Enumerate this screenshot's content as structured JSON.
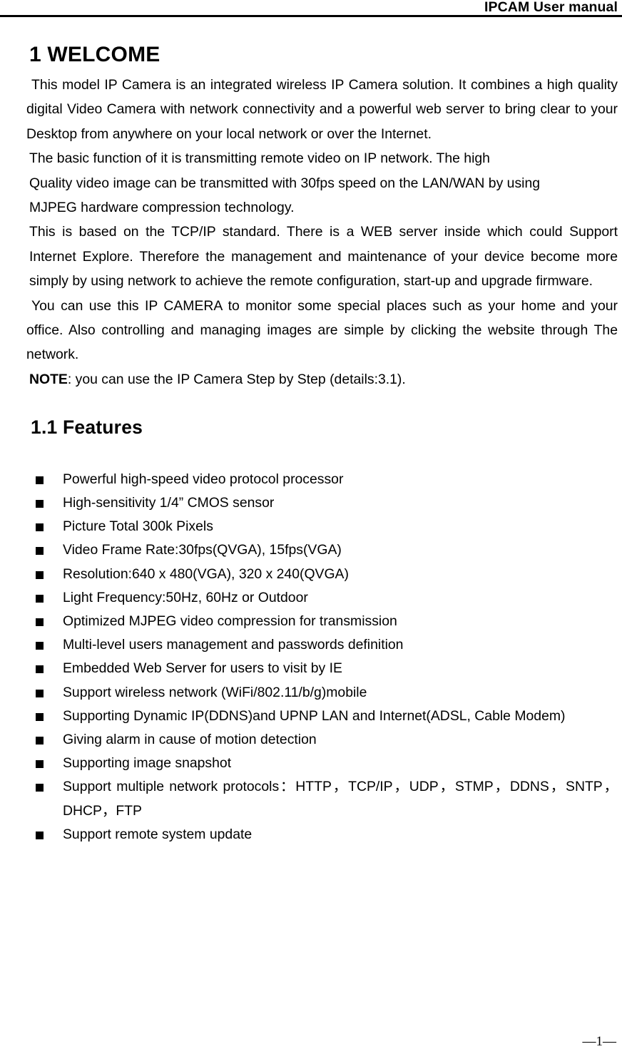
{
  "header": {
    "title": "IPCAM User manual"
  },
  "headings": {
    "h1": "1 WELCOME",
    "h2": "1.1 Features"
  },
  "intro": {
    "paragraph1": "This model IP Camera is an integrated wireless IP Camera solution. It combines a high quality digital Video Camera with network connectivity and a powerful web server to bring clear to your Desktop from anywhere on your local network or over the Internet.",
    "line_basic_1": "The basic function of it is transmitting remote video on IP network. The high",
    "line_basic_2": "Quality video image can be transmitted with 30fps speed on the LAN/WAN by using",
    "line_basic_3": "MJPEG hardware compression technology.",
    "paragraph_tcpip": "This is based on the TCP/IP standard. There is a WEB server inside which could Support Internet Explore. Therefore the management and maintenance of your device become more simply by using network to achieve the remote configuration, start-up and upgrade firmware.",
    "paragraph_monitor": "You can use this IP CAMERA to monitor some special places such as your home and your office. Also controlling and managing images are simple by clicking the website through The network.",
    "note_label": "NOTE",
    "note_text": ": you can use the IP Camera Step by Step (details:3.1)."
  },
  "features": {
    "items": [
      "Powerful high-speed video protocol processor",
      "High-sensitivity 1/4” CMOS sensor",
      "Picture Total 300k Pixels",
      "Video Frame Rate:30fps(QVGA), 15fps(VGA)",
      "Resolution:640 x 480(VGA), 320 x 240(QVGA)",
      "Light Frequency:50Hz, 60Hz or Outdoor",
      "Optimized MJPEG video compression for transmission",
      "Multi-level users management and passwords definition",
      "Embedded Web Server for users to visit by IE",
      "Support wireless network (WiFi/802.11/b/g)mobile",
      "Supporting Dynamic IP(DDNS)and UPNP LAN and Internet(ADSL, Cable Modem)",
      "Giving alarm in cause of motion detection",
      "Supporting image snapshot",
      "Support multiple network protocols：HTTP，TCP/IP，UDP，STMP，DDNS，SNTP，DHCP，FTP",
      "Support remote system update"
    ]
  },
  "footer": {
    "page_number": "—1—"
  }
}
